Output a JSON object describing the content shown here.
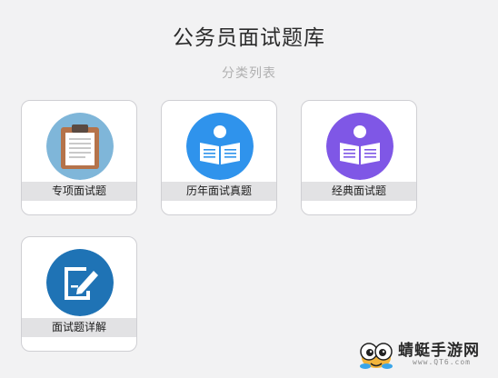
{
  "header": {
    "title": "公务员面试题库",
    "subtitle": "分类列表"
  },
  "categories": [
    {
      "label": "专项面试题",
      "icon": "clipboard-icon",
      "color": "#7fb6d9"
    },
    {
      "label": "历年面试真题",
      "icon": "reader-icon",
      "color": "#2f93ec"
    },
    {
      "label": "经典面试题",
      "icon": "reader-icon",
      "color": "#7f57e6"
    },
    {
      "label": "面试题详解",
      "icon": "edit-document-icon",
      "color": "#1f73b5"
    }
  ],
  "watermark": {
    "text": "蜻蜓手游网",
    "url": "www.QT6.com"
  }
}
